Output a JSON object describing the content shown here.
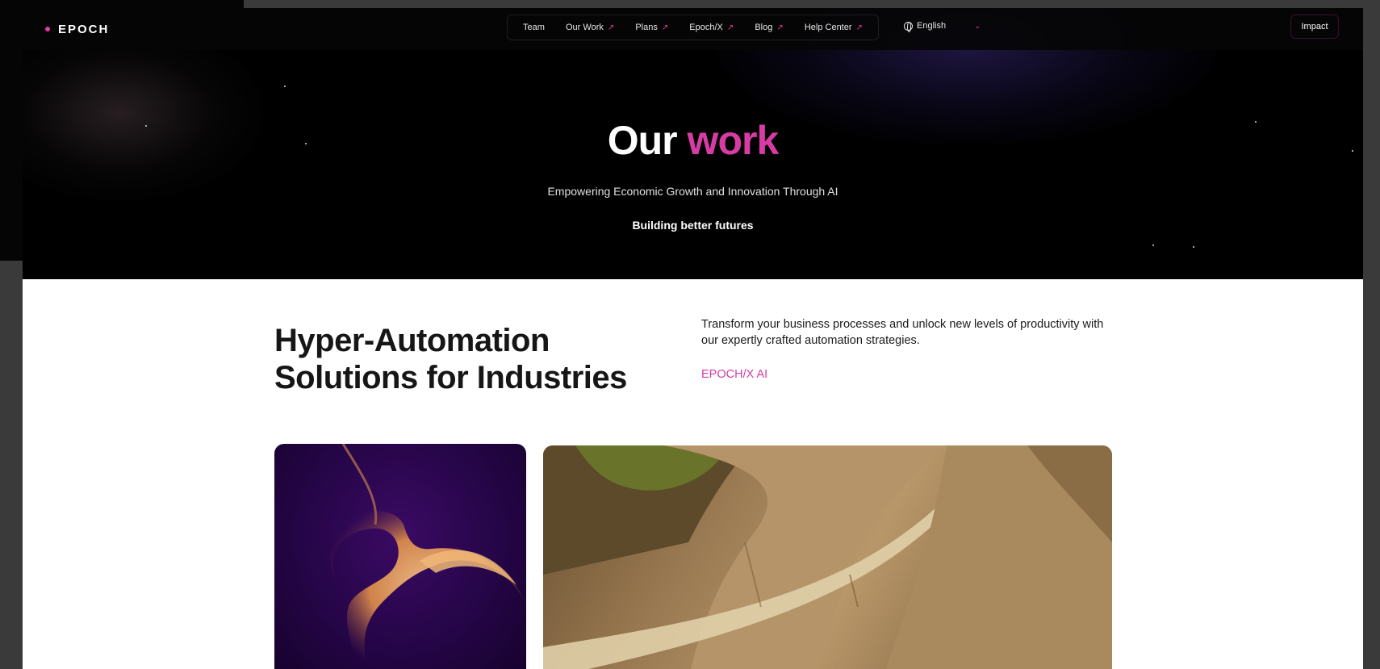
{
  "nav": {
    "logo": "EPOCH",
    "items": [
      {
        "label": "Team",
        "external": false
      },
      {
        "label": "Our Work",
        "external": true
      },
      {
        "label": "Plans",
        "external": true
      },
      {
        "label": "Epoch/X",
        "external": true
      },
      {
        "label": "Blog",
        "external": true
      },
      {
        "label": "Help Center",
        "external": true
      }
    ],
    "external_arrow": "↗",
    "language": "English",
    "language_chevron": "⌄",
    "cta": "Impact"
  },
  "hero": {
    "title_plain": "Our",
    "title_accent": "work",
    "subtitle": "Empowering Economic Growth and Innovation Through AI",
    "tagline": "Building better futures"
  },
  "section": {
    "heading_line1": "Hyper-Automation",
    "heading_line2": "Solutions for Industries",
    "description": "Transform your business processes and unlock new levels of productivity with our expertly crafted automation strategies.",
    "link": "EPOCH/X AI"
  },
  "colors": {
    "accent": "#d63ca4",
    "hero_bg": "#000000",
    "content_bg": "#ffffff",
    "heading_text": "#161616"
  },
  "icons": {
    "language": "globe-icon",
    "dropdown": "chevron-down-icon",
    "external": "arrow-up-right-icon"
  }
}
